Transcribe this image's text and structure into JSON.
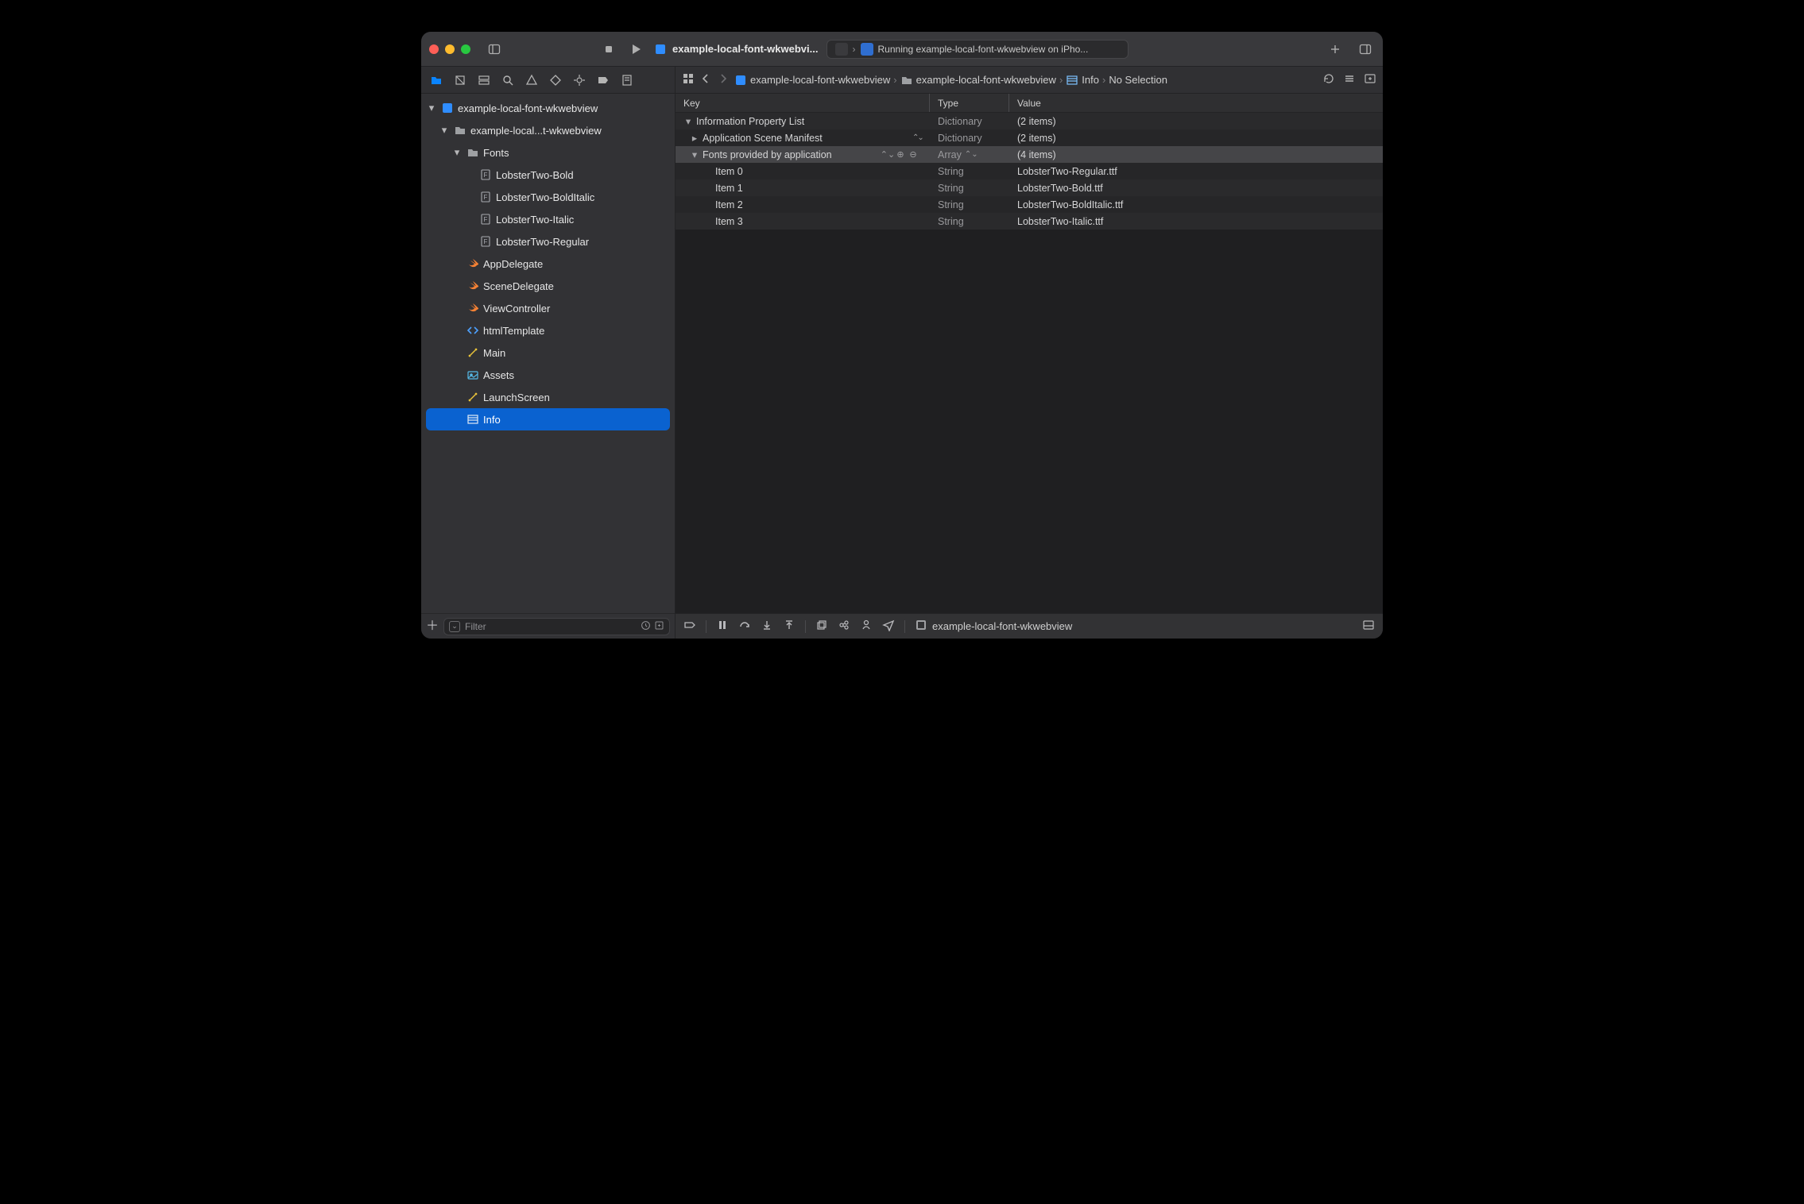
{
  "toolbar": {
    "tab_title": "example-local-font-wkwebvi...",
    "run_status": "Running example-local-font-wkwebview on iPho..."
  },
  "breadcrumbs": {
    "items": [
      "example-local-font-wkwebview",
      "example-local-font-wkwebview",
      "Info",
      "No Selection"
    ]
  },
  "sidebar": {
    "filter_placeholder": "Filter",
    "tree": {
      "root": "example-local-font-wkwebview",
      "group": "example-local...t-wkwebview",
      "fonts_folder": "Fonts",
      "fonts": [
        "LobsterTwo-Bold",
        "LobsterTwo-BoldItalic",
        "LobsterTwo-Italic",
        "LobsterTwo-Regular"
      ],
      "files": {
        "appdelegate": "AppDelegate",
        "scenedelegate": "SceneDelegate",
        "viewcontroller": "ViewController",
        "htmltemplate": "htmlTemplate",
        "main": "Main",
        "assets": "Assets",
        "launchscreen": "LaunchScreen",
        "info": "Info"
      }
    }
  },
  "plist": {
    "headers": {
      "key": "Key",
      "type": "Type",
      "value": "Value"
    },
    "rows": [
      {
        "key": "Information Property List",
        "type": "Dictionary",
        "value": "(2 items)"
      },
      {
        "key": "Application Scene Manifest",
        "type": "Dictionary",
        "value": "(2 items)"
      },
      {
        "key": "Fonts provided by application",
        "type": "Array",
        "value": "(4 items)"
      },
      {
        "key": "Item 0",
        "type": "String",
        "value": "LobsterTwo-Regular.ttf"
      },
      {
        "key": "Item 1",
        "type": "String",
        "value": "LobsterTwo-Bold.ttf"
      },
      {
        "key": "Item 2",
        "type": "String",
        "value": "LobsterTwo-BoldItalic.ttf"
      },
      {
        "key": "Item 3",
        "type": "String",
        "value": "LobsterTwo-Italic.ttf"
      }
    ]
  },
  "debugbar": {
    "process": "example-local-font-wkwebview"
  }
}
